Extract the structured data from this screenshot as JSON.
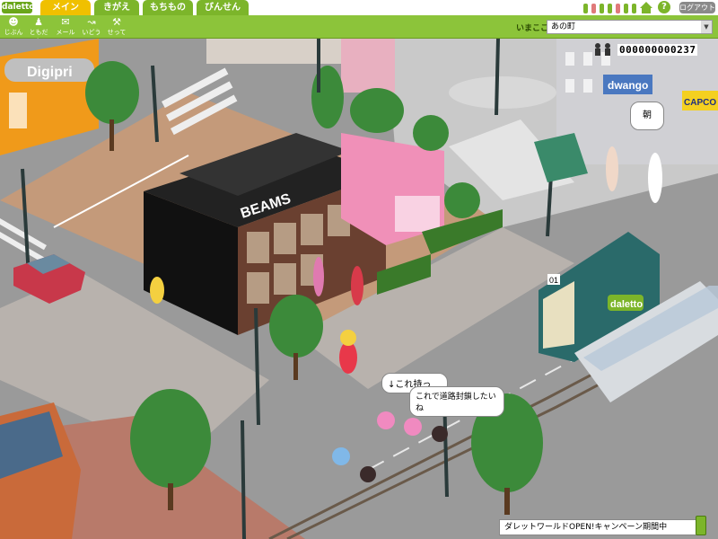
{
  "brand": {
    "logo": "daletto"
  },
  "tabs": [
    {
      "label": "メイン",
      "active": true
    },
    {
      "label": "きがえ",
      "active": false
    },
    {
      "label": "もちもの",
      "active": false
    },
    {
      "label": "びんせん",
      "active": false
    }
  ],
  "topright": {
    "logout_label": "ログアウト",
    "help": "?"
  },
  "toolbar": [
    {
      "label": "じぶん",
      "icon": "person-icon"
    },
    {
      "label": "ともだち",
      "icon": "friends-icon"
    },
    {
      "label": "メール",
      "icon": "mail-icon"
    },
    {
      "label": "いどう",
      "icon": "move-icon"
    },
    {
      "label": "せってい",
      "icon": "wrench-icon"
    }
  ],
  "location": {
    "label": "いまここ",
    "value": "あの町"
  },
  "counter": {
    "value": "000000000237"
  },
  "scene": {
    "shop_signs": [
      "Digipri",
      "BEAMS",
      "dwango",
      "CAPCO",
      "daletto"
    ],
    "tram_number": "01"
  },
  "chat": [
    {
      "text": "朝"
    },
    {
      "text": "↓これ持っ"
    },
    {
      "text": "これで道路封鎖したいね"
    }
  ],
  "news": {
    "text": "ダレットワールドOPEN!キャンペーン期間中"
  },
  "colors": {
    "accent": "#8cc43a",
    "tab_active": "#f0c000",
    "tab_inactive": "#7cb52a"
  }
}
